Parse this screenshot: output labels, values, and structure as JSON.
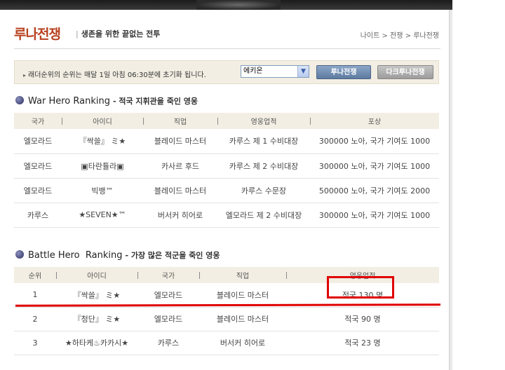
{
  "header": {
    "title": "루나전쟁",
    "subtitle": "생존을 위한 끝없는 전투",
    "breadcrumb": "나이트 > 전쟁 > 루나전쟁"
  },
  "notice": {
    "text": "래더순위의 순위는 매달 1일 아침 06:30분에 초기화 됩니다.",
    "server_select": "에키온",
    "btn_luna": "루나전쟁",
    "btn_dark": "다크루나전쟁"
  },
  "war_hero": {
    "title": "War Hero Ranking",
    "subtitle": "- 적국 지휘관을 죽인 영웅",
    "columns": [
      "국가",
      "아이디",
      "직업",
      "영웅업적",
      "포상"
    ],
    "rows": [
      [
        "엘모라드",
        "『싹쓸』 ミ★",
        "블레이드 마스터",
        "카루스 제 1 수비대장",
        "300000 노아, 국가 기여도 1000"
      ],
      [
        "엘모라드",
        "▣타란튤라▣",
        "카사르 후드",
        "카루스 제 2 수비대장",
        "300000 노아, 국가 기여도 1000"
      ],
      [
        "엘모라드",
        "빅뱅™",
        "블레이드 마스터",
        "카루스 수문장",
        "500000 노아, 국가 기여도 2000"
      ],
      [
        "카루스",
        "★SEVEN★™",
        "버서커 히어로",
        "엘모라드 제 2 수비대장",
        "300000 노아, 국가 기여도 1000"
      ]
    ]
  },
  "battle_hero": {
    "title": "Battle Hero  Ranking",
    "subtitle": "- 가장 많은 적군을 죽인 영웅",
    "columns": [
      "순위",
      "아이디",
      "국가",
      "직업",
      "영웅업적"
    ],
    "rows": [
      [
        "1",
        "『싹쓸』 ミ★",
        "엘모라드",
        "블레이드 마스터",
        "적국 130 명"
      ],
      [
        "2",
        "『청단』 ミ★",
        "엘모라드",
        "블레이드 마스터",
        "적국 90 명"
      ],
      [
        "3",
        "★하타케♨카카시★",
        "카루스",
        "버서커 히어로",
        "적국 23 명"
      ]
    ]
  },
  "colors": {
    "title": "#b8401e",
    "annotation": "#e00000",
    "header_bg": "#f2eee3"
  }
}
